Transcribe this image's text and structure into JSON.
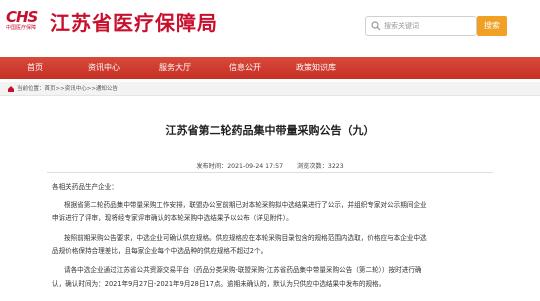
{
  "header": {
    "logo_mark": "CHS",
    "logo_sub": "中国医疗保障",
    "site_title": "江苏省医疗保障局",
    "search_placeholder": "搜索关键词",
    "search_button": "搜索"
  },
  "nav": {
    "items": [
      "首页",
      "资讯中心",
      "服务大厅",
      "信息公开",
      "政策知识库"
    ]
  },
  "breadcrumb": {
    "text": "当前位置：首页>>资讯中心>>通知公告"
  },
  "article": {
    "title": "江苏省第二轮药品集中带量采购公告（九）",
    "publish_time": "发布时间：2021-09-24 17:57",
    "views": "浏览次数：3223",
    "greeting": "各相关药品生产企业：",
    "paragraphs": [
      "根据省第二轮药品集中带量采购工作安排，联盟办公室前期已对本轮采购拟中选结果进行了公示，并组织专家对公示期间企业",
      "申诉进行了评审，现将经专家评审确认的本轮采购中选结果予以公布（详见附件）。",
      "按照前期采购公告要求，中选企业可确认供应规格。供应规格应在本轮采购目录包含的规格范围内选取，价格应与本企业中选",
      "品规价格保持合理差比，且每家企业每个中选品种的供应规格不超过2个。",
      "请各中选企业通过江苏省公共资源交易平台（药品分类采购-联盟采购-江苏省药品集中带量采购公告（第二轮））按时进行确",
      "认，确认时间为：2021年9月27日-2021年9月28日17点。逾期未确认的，默认为只供应中选结果中发布的规格。"
    ]
  },
  "colors": {
    "brand_red": "#c8102e",
    "nav_red": "#c62f24",
    "search_orange": "#f0a023"
  }
}
